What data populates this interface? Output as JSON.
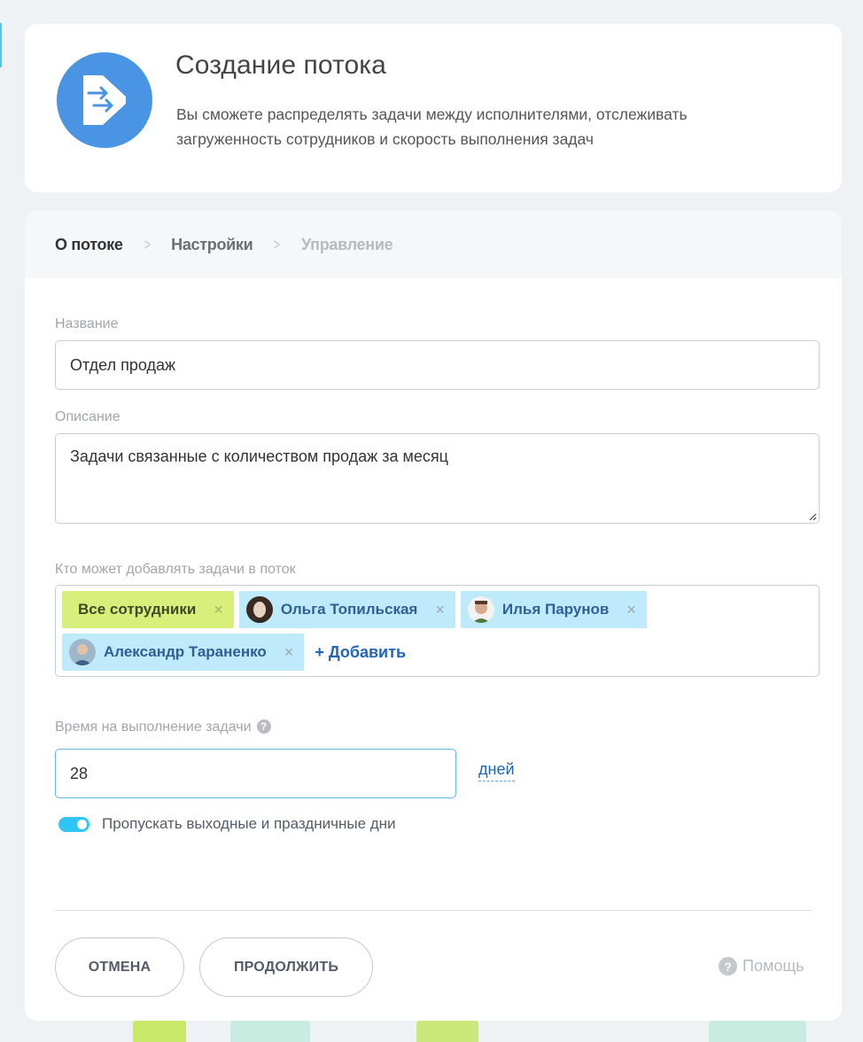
{
  "header": {
    "title": "Создание потока",
    "description": "Вы сможете распределять задачи между исполнителями, отслеживать загруженность сотрудников и скорость выполнения задач",
    "logo_icon": "flow-arrows-icon",
    "logo_color": "#4a94e4"
  },
  "steps": [
    {
      "label": "О потоке",
      "state": "active"
    },
    {
      "label": "Настройки",
      "state": "normal"
    },
    {
      "label": "Управление",
      "state": "disabled"
    }
  ],
  "form": {
    "name_label": "Название",
    "name_value": "Отдел продаж",
    "description_label": "Описание",
    "description_value": "Задачи связанные с количеством продаж за месяц",
    "who_can_add_label": "Кто может добавлять задачи в поток",
    "tags": [
      {
        "label": "Все сотрудники",
        "type": "group"
      },
      {
        "label": "Ольга Топильская",
        "type": "user"
      },
      {
        "label": "Илья Парунов",
        "type": "user"
      },
      {
        "label": "Александр Тараненко",
        "type": "user"
      }
    ],
    "add_label": "+ Добавить",
    "time_label": "Время на выполнение задачи",
    "time_value": "28",
    "time_unit": "дней",
    "skip_weekends_label": "Пропускать выходные и праздничные дни",
    "skip_weekends_enabled": true
  },
  "buttons": {
    "cancel": "ОТМЕНА",
    "continue": "ПРОДОЛЖИТЬ",
    "help": "Помощь"
  },
  "colors": {
    "accent": "#2fc6f6",
    "link": "#2065b8",
    "tag_group_bg": "#d8f07b",
    "tag_user_bg": "#bfeafb"
  }
}
